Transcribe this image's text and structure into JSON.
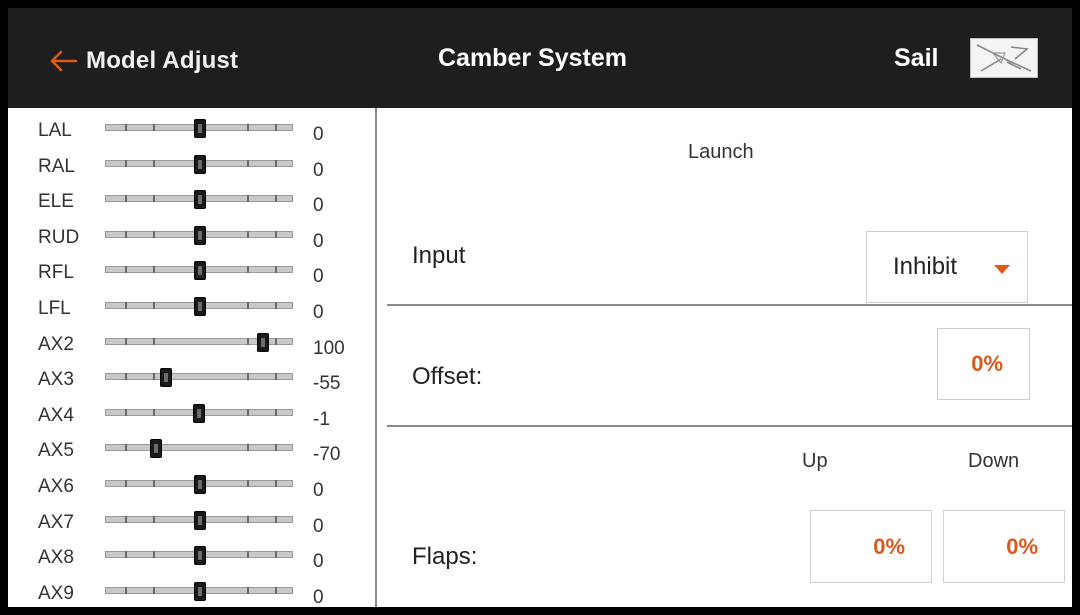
{
  "header": {
    "back_label": "Model Adjust",
    "title": "Camber System",
    "model_name": "Sail",
    "model_icon": "glider-icon",
    "back_icon": "arrow-left-icon",
    "accent_color": "#e05a17"
  },
  "monitor": {
    "channels": [
      {
        "name": "LAL",
        "value": "0"
      },
      {
        "name": "RAL",
        "value": "0"
      },
      {
        "name": "ELE",
        "value": "0"
      },
      {
        "name": "RUD",
        "value": "0"
      },
      {
        "name": "RFL",
        "value": "0"
      },
      {
        "name": "LFL",
        "value": "0"
      },
      {
        "name": "AX2",
        "value": "100"
      },
      {
        "name": "AX3",
        "value": "-55"
      },
      {
        "name": "AX4",
        "value": "-1"
      },
      {
        "name": "AX5",
        "value": "-70"
      },
      {
        "name": "AX6",
        "value": "0"
      },
      {
        "name": "AX7",
        "value": "0"
      },
      {
        "name": "AX8",
        "value": "0"
      },
      {
        "name": "AX9",
        "value": "0"
      }
    ]
  },
  "panel": {
    "section": "Launch",
    "input_label": "Input",
    "input_value": "Inhibit",
    "offset_label": "Offset:",
    "offset_value": "0%",
    "col_up": "Up",
    "col_down": "Down",
    "flaps_label": "Flaps:",
    "flaps_up": "0%",
    "flaps_down": "0%"
  }
}
